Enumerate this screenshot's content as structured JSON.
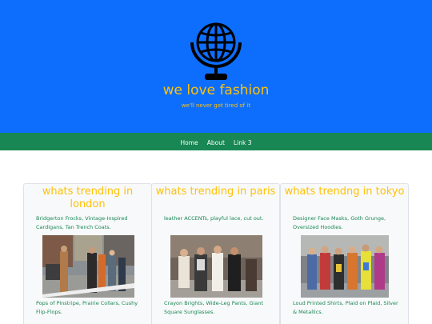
{
  "header": {
    "title": "we love fashion",
    "tagline": "we'll never get tired of it",
    "logo_icon": "globe-on-stand-icon",
    "background": "#0d6efd",
    "accent": "#ffc107"
  },
  "nav": {
    "background": "#198754",
    "links": [
      "Home",
      "About",
      "Link 3"
    ]
  },
  "cards": [
    {
      "title": "whats trending in london",
      "text": "Bridgerton Frocks, Vintage-Inspired Cardigans, Tan Trench Coats.",
      "caption": "Pops of Pinstripe, Prairie Collars, Cushy Flip-Flops."
    },
    {
      "title": "whats trending in paris",
      "text": "leather ACCENTs, playful lace, cut out.",
      "caption": "Crayon Brights, Wide-Leg Pants, Giant Square Sunglasses."
    },
    {
      "title": "whats trendng in tokyo",
      "text": "Designer Face Masks, Goth Grunge, Oversized Hoodies.",
      "caption": "Loud Printed Shirts, Plaid on Plaid, Silver & Metallics."
    }
  ]
}
